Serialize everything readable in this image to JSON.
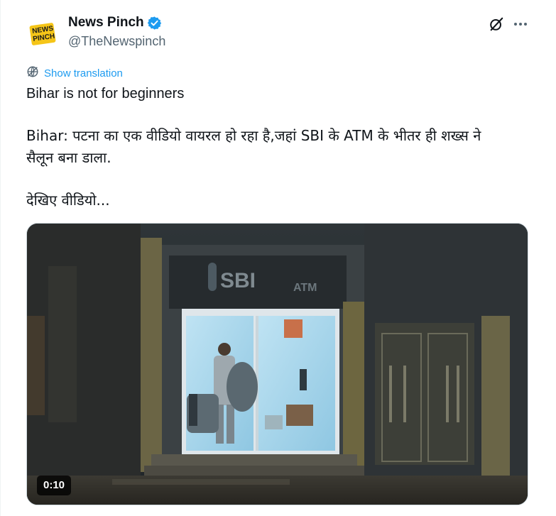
{
  "author": {
    "display_name": "News Pinch",
    "handle": "@TheNewspinch",
    "avatar_text": "NEWS PINCH",
    "verified": true
  },
  "header_actions": {
    "grok_icon": "grok-icon",
    "more_icon": "more-dots-icon"
  },
  "translation": {
    "label": "Show translation",
    "icon": "translate-globe-icon"
  },
  "tweet": {
    "line1": "Bihar is not for beginners",
    "line2": "Bihar: पटना का एक वीडियो वायरल हो रहा है,जहां SBI के ATM के भीतर ही शख्स ने",
    "line3": "सैलून बना डाला.",
    "line4": "देखिए वीडियो..."
  },
  "media": {
    "duration": "0:10",
    "sign_text": "SBI",
    "atm_text": "ATM"
  },
  "colors": {
    "accent": "#1d9bf0",
    "secondary_text": "#536471",
    "primary_text": "#0f1419"
  }
}
